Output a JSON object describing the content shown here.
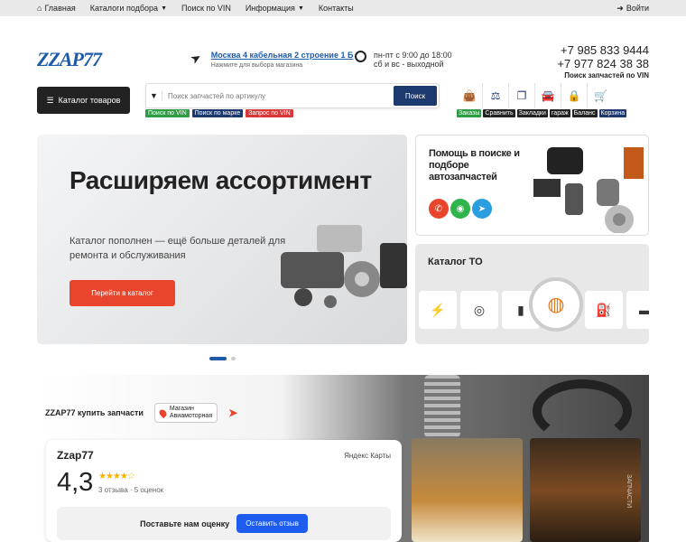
{
  "topnav": {
    "items": [
      {
        "label": "Главная",
        "icon": "home-icon"
      },
      {
        "label": "Каталоги подбора",
        "caret": true
      },
      {
        "label": "Поиск по VIN"
      },
      {
        "label": "Информация",
        "caret": true
      },
      {
        "label": "Контакты"
      }
    ],
    "login": "Войти"
  },
  "header": {
    "logo": "ZZAP77",
    "address": "Москва 4 кабельная 2 строение 1 Б",
    "address_hint": "Нажмите для выбора магазина",
    "hours_line1": "пн-пт с 9:00 до 18:00",
    "hours_line2": "сб и вс - выходной",
    "phone1": "+7 985 833 9444",
    "phone2": "+7 977 824 38 38",
    "vin_link": "Поиск запчастей по VIN"
  },
  "search": {
    "catalog_button": "Каталог товаров",
    "placeholder": "Поиск запчастей по артикулу",
    "button": "Поиск",
    "tabs": [
      {
        "label": "Поиск по VIN",
        "color": "#2e9d45"
      },
      {
        "label": "Поиск по марке",
        "color": "#1d3a6e"
      },
      {
        "label": "Запрос по VIN",
        "color": "#d9383a"
      }
    ]
  },
  "user_icons": [
    {
      "icon": "orders-icon",
      "label": "Заказы",
      "color": "#2e9d45"
    },
    {
      "icon": "compare-icon",
      "label": "Сравнить",
      "color": "#222222"
    },
    {
      "icon": "bookmarks-icon",
      "label": "Закладки",
      "color": "#222222"
    },
    {
      "icon": "garage-icon",
      "label": "гараж",
      "color": "#222222"
    },
    {
      "icon": "balance-icon",
      "label": "Баланс",
      "color": "#222222"
    },
    {
      "icon": "cart-icon",
      "label": "Корзина",
      "color": "#1d3a6e"
    }
  ],
  "banner": {
    "title": "Расширяем ассортимент",
    "text": "Каталог пополнен — ещё больше деталей для ремонта и обслуживания",
    "cta": "Перейти в каталог"
  },
  "help_card": {
    "title": "Помощь в поиске и подборе автозапчастей",
    "contacts": [
      {
        "icon": "phone-icon",
        "color": "#e8452c"
      },
      {
        "icon": "whatsapp-icon",
        "color": "#2fb34a"
      },
      {
        "icon": "telegram-icon",
        "color": "#2a9ee0"
      }
    ]
  },
  "to_card": {
    "title": "Каталог ТО"
  },
  "shop": {
    "label": "ZZAP77 купить запчасти",
    "store_line1": "Магазин",
    "store_line2": "Авиамоторная"
  },
  "review": {
    "name": "Zzap77",
    "source": "Яндекс Карты",
    "rating": "4,3",
    "stars": "★★★★☆",
    "counts": "3 отзыва · 5 оценок",
    "prompt": "Поставьте нам оценку",
    "button": "Оставить отзыв"
  },
  "photo_text": "ЗАПЧАСТИ"
}
